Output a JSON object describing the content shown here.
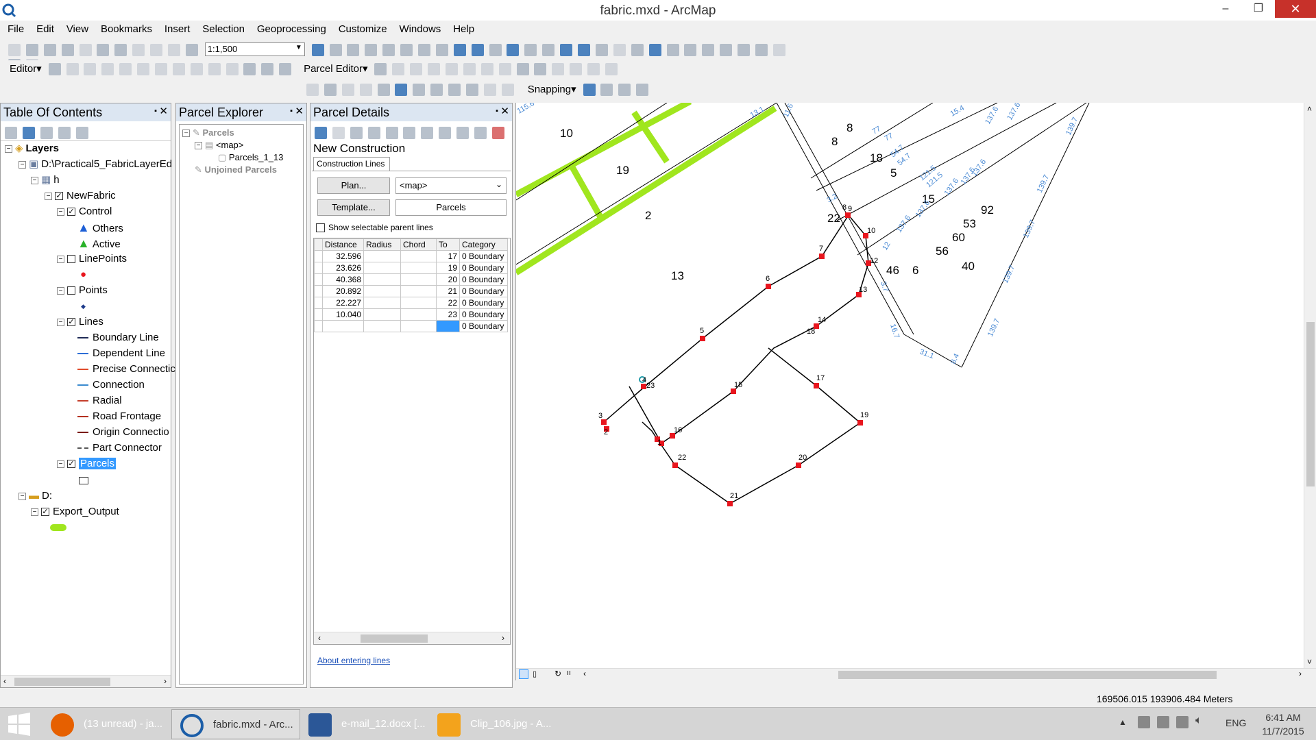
{
  "window": {
    "title": "fabric.mxd - ArcMap",
    "minimize": "–",
    "restore": "❐",
    "close": "✕"
  },
  "menu": [
    "File",
    "Edit",
    "View",
    "Bookmarks",
    "Insert",
    "Selection",
    "Geoprocessing",
    "Customize",
    "Windows",
    "Help"
  ],
  "toolbar": {
    "scale": "1:1,500",
    "editor_label": "Editor▾",
    "parcel_editor_label": "Parcel Editor▾",
    "snapping_label": "Snapping▾"
  },
  "toc": {
    "title": "Table Of Contents",
    "items": [
      {
        "label": "Layers"
      },
      {
        "label": "D:\\Practical5_FabricLayerEd"
      },
      {
        "label": "h"
      },
      {
        "label": "NewFabric"
      },
      {
        "label": "Control"
      },
      {
        "label": "Others"
      },
      {
        "label": "Active"
      },
      {
        "label": "LinePoints"
      },
      {
        "label": "Points"
      },
      {
        "label": "Lines"
      },
      {
        "label": "Boundary Line"
      },
      {
        "label": "Dependent Line"
      },
      {
        "label": "Precise Connectic"
      },
      {
        "label": "Connection"
      },
      {
        "label": "Radial"
      },
      {
        "label": "Road Frontage"
      },
      {
        "label": "Origin Connectio"
      },
      {
        "label": "Part Connector"
      },
      {
        "label": "Parcels"
      },
      {
        "label": "D:"
      },
      {
        "label": "Export_Output"
      }
    ]
  },
  "explorer": {
    "title": "Parcel Explorer",
    "items": [
      {
        "label": "Parcels"
      },
      {
        "label": "<map>"
      },
      {
        "label": "Parcels_1_13"
      },
      {
        "label": "Unjoined Parcels"
      }
    ]
  },
  "details": {
    "title": "Parcel Details",
    "section": "New Construction",
    "tab": "Construction Lines",
    "plan_button": "Plan...",
    "plan_value": "<map>",
    "template_button": "Template...",
    "template_value": "Parcels",
    "show_parent_lines": "Show selectable parent lines",
    "columns": [
      "Distance",
      "Radius",
      "Chord",
      "To",
      "Category"
    ],
    "rows": [
      {
        "distance": "32.596",
        "radius": "",
        "chord": "",
        "to": "17",
        "category": "0 Boundary"
      },
      {
        "distance": "23.626",
        "radius": "",
        "chord": "",
        "to": "19",
        "category": "0 Boundary"
      },
      {
        "distance": "40.368",
        "radius": "",
        "chord": "",
        "to": "20",
        "category": "0 Boundary"
      },
      {
        "distance": "20.892",
        "radius": "",
        "chord": "",
        "to": "21",
        "category": "0 Boundary"
      },
      {
        "distance": "22.227",
        "radius": "",
        "chord": "",
        "to": "22",
        "category": "0 Boundary"
      },
      {
        "distance": "10.040",
        "radius": "",
        "chord": "",
        "to": "23",
        "category": "0 Boundary"
      },
      {
        "distance": "",
        "radius": "",
        "chord": "",
        "to": "",
        "category": "0 Boundary"
      }
    ],
    "help_link": "About entering lines"
  },
  "map": {
    "parcel_numbers": [
      "10",
      "19",
      "2",
      "13",
      "8",
      "8",
      "18",
      "5",
      "15",
      "22",
      "92",
      "53",
      "60",
      "56",
      "46",
      "6",
      "40"
    ],
    "point_labels": [
      "1",
      "2",
      "3",
      "4",
      "5",
      "6",
      "7",
      "8",
      "9",
      "10",
      "12",
      "13",
      "14",
      "15",
      "16",
      "17",
      "18",
      "19",
      "20",
      "21",
      "22",
      "23"
    ],
    "dimension_labels": [
      "115.6",
      "13.1",
      "11.6",
      "77",
      "77",
      "54.7",
      "54.7",
      "15.4",
      "137.6",
      "137.6",
      "139.7",
      "121.5",
      "121.5",
      "137.6",
      "137.6",
      "137.6",
      "139.7",
      "137.6",
      "137.6",
      "139.7",
      "139.7",
      "139.7",
      "3.2",
      "31.1",
      "8.4",
      "16.7",
      "3.7",
      "12"
    ]
  },
  "status": {
    "coordinates": "169506.015  193906.484 Meters"
  },
  "taskbar": {
    "items": [
      {
        "label": "(13 unread) - ja..."
      },
      {
        "label": "fabric.mxd - Arc..."
      },
      {
        "label": "e-mail_12.docx [..."
      },
      {
        "label": "Clip_106.jpg - A..."
      }
    ],
    "language": "ENG",
    "time": "6:41 AM",
    "date": "11/7/2015"
  },
  "colors": {
    "accent": "#3399ff",
    "green_parcel": "#a0e61e",
    "point_red": "#e8161e",
    "dimension_blue": "#4a8ad4"
  }
}
